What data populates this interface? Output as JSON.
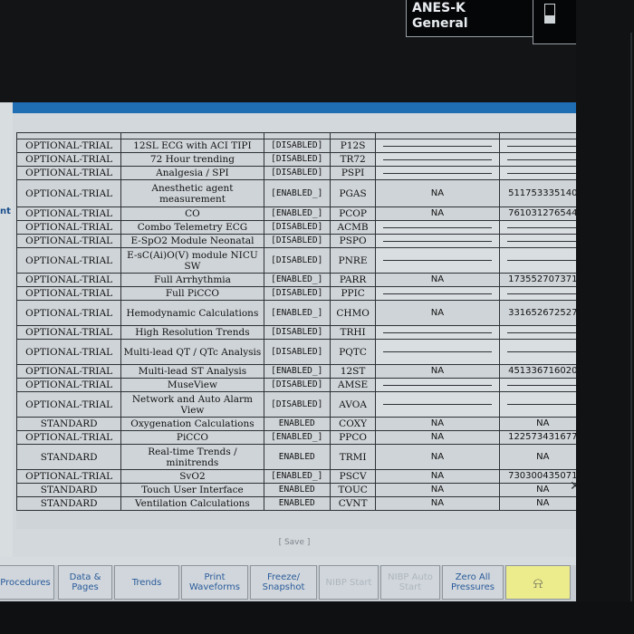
{
  "status": {
    "profile": "ANES-K",
    "care_area": "General"
  },
  "left_cut_text": "nt",
  "rows": [
    {
      "type": "OPTIONAL-TRIAL",
      "name": "12SL ECG with ACI TIPI",
      "status": "[DISABLED]",
      "code": "P12S",
      "value": "",
      "id": ""
    },
    {
      "type": "OPTIONAL-TRIAL",
      "name": "72 Hour trending",
      "status": "[DISABLED]",
      "code": "TR72",
      "value": "",
      "id": ""
    },
    {
      "type": "OPTIONAL-TRIAL",
      "name": "Analgesia / SPI",
      "status": "[DISABLED]",
      "code": "PSPI",
      "value": "",
      "id": ""
    },
    {
      "type": "OPTIONAL-TRIAL",
      "name": "Anesthetic agent measurement",
      "status": "[ENABLED_]",
      "code": "PGAS",
      "value": "NA",
      "id": "511753335140"
    },
    {
      "type": "OPTIONAL-TRIAL",
      "name": "CO",
      "status": "[ENABLED_]",
      "code": "PCOP",
      "value": "NA",
      "id": "761031276544"
    },
    {
      "type": "OPTIONAL-TRIAL",
      "name": "Combo Telemetry ECG",
      "status": "[DISABLED]",
      "code": "ACMB",
      "value": "",
      "id": ""
    },
    {
      "type": "OPTIONAL-TRIAL",
      "name": "E-SpO2 Module Neonatal",
      "status": "[DISABLED]",
      "code": "PSPO",
      "value": "",
      "id": ""
    },
    {
      "type": "OPTIONAL-TRIAL",
      "name": "E-sC(Ai)O(V) module NICU SW",
      "status": "[DISABLED]",
      "code": "PNRE",
      "value": "",
      "id": ""
    },
    {
      "type": "OPTIONAL-TRIAL",
      "name": "Full Arrhythmia",
      "status": "[ENABLED_]",
      "code": "PARR",
      "value": "NA",
      "id": "173552707371"
    },
    {
      "type": "OPTIONAL-TRIAL",
      "name": "Full PiCCO",
      "status": "[DISABLED]",
      "code": "PPIC",
      "value": "",
      "id": ""
    },
    {
      "type": "OPTIONAL-TRIAL",
      "name": "Hemodynamic Calculations",
      "status": "[ENABLED_]",
      "code": "CHMO",
      "value": "NA",
      "id": "331652672527"
    },
    {
      "type": "OPTIONAL-TRIAL",
      "name": "High Resolution Trends",
      "status": "[DISABLED]",
      "code": "TRHI",
      "value": "",
      "id": ""
    },
    {
      "type": "OPTIONAL-TRIAL",
      "name": "Multi-lead QT / QTc Analysis",
      "status": "[DISABLED]",
      "code": "PQTC",
      "value": "",
      "id": ""
    },
    {
      "type": "OPTIONAL-TRIAL",
      "name": "Multi-lead ST Analysis",
      "status": "[ENABLED_]",
      "code": "12ST",
      "value": "NA",
      "id": "451336716020"
    },
    {
      "type": "OPTIONAL-TRIAL",
      "name": "MuseView",
      "status": "[DISABLED]",
      "code": "AMSE",
      "value": "",
      "id": ""
    },
    {
      "type": "OPTIONAL-TRIAL",
      "name": "Network and Auto Alarm View",
      "status": "[DISABLED]",
      "code": "AVOA",
      "value": "",
      "id": ""
    },
    {
      "type": "STANDARD",
      "name": "Oxygenation Calculations",
      "status": "ENABLED",
      "code": "COXY",
      "value": "NA",
      "id": "NA"
    },
    {
      "type": "OPTIONAL-TRIAL",
      "name": "PiCCO",
      "status": "[ENABLED_]",
      "code": "PPCO",
      "value": "NA",
      "id": "122573431677"
    },
    {
      "type": "STANDARD",
      "name": "Real-time Trends / minitrends",
      "status": "ENABLED",
      "code": "TRMI",
      "value": "NA",
      "id": "NA"
    },
    {
      "type": "OPTIONAL-TRIAL",
      "name": "SvO2",
      "status": "[ENABLED_]",
      "code": "PSCV",
      "value": "NA",
      "id": "730300435071"
    },
    {
      "type": "STANDARD",
      "name": "Touch User Interface",
      "status": "ENABLED",
      "code": "TOUC",
      "value": "NA",
      "id": "NA"
    },
    {
      "type": "STANDARD",
      "name": "Ventilation Calculations",
      "status": "ENABLED",
      "code": "CVNT",
      "value": "NA",
      "id": "NA"
    }
  ],
  "save_label": "[ Save ]",
  "softkeys": [
    {
      "label": "Procedures",
      "dim": false
    },
    {
      "label": "Data & Pages",
      "dim": false
    },
    {
      "label": "Trends",
      "dim": false
    },
    {
      "label": "Print Waveforms",
      "dim": false
    },
    {
      "label": "Freeze/ Snapshot",
      "dim": false
    },
    {
      "label": "NIBP Start",
      "dim": true
    },
    {
      "label": "NIBP Auto Start",
      "dim": true
    },
    {
      "label": "Zero All Pressures",
      "dim": false
    }
  ],
  "alarm_icon": "alarm-bell-crossed-icon"
}
